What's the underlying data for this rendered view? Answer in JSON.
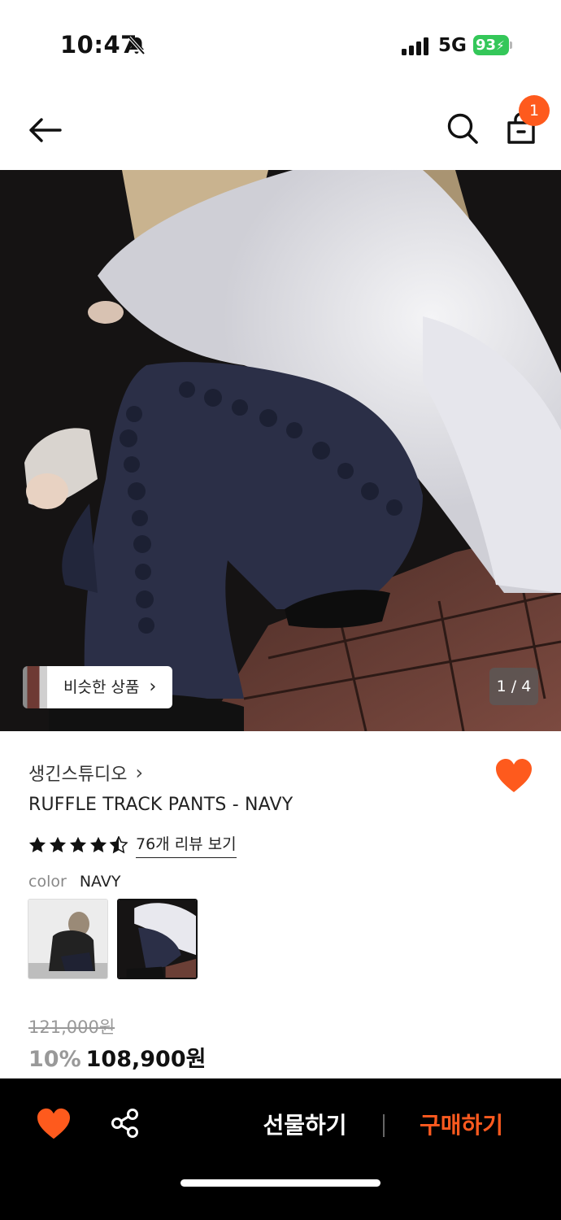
{
  "status_bar": {
    "time": "10:47",
    "network": "5G",
    "battery": "93",
    "bell_icon": "bell-slash-icon",
    "signal_icon": "signal-bars-icon"
  },
  "header": {
    "back_icon": "arrow-left-icon",
    "search_icon": "search-icon",
    "cart_icon": "shopping-bag-icon",
    "cart_count": "1",
    "accent_color": "#fe5a1d"
  },
  "hero": {
    "similar_label": "비슷한 상품",
    "similar_chevron": "›",
    "page_indicator": "1 / 4"
  },
  "product": {
    "brand": "생긴스튜디오",
    "brand_chevron": "›",
    "title": "RUFFLE TRACK PANTS - NAVY",
    "rating_stars": 4.5,
    "review_link": "76개 리뷰 보기",
    "color_label": "color",
    "color_value": "NAVY",
    "original_price": "121,000원",
    "discount": "10%",
    "sale_price": "108,900원",
    "wishlist_color": "#fe5a1d"
  },
  "bottom_bar": {
    "gift_label": "선물하기",
    "buy_label": "구매하기",
    "buy_color": "#ff5a1f"
  }
}
